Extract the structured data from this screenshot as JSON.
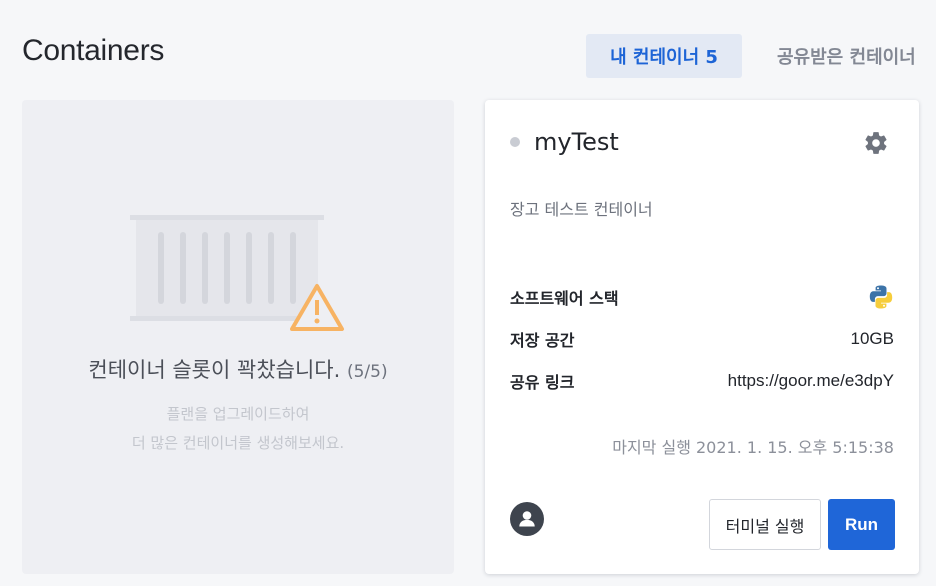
{
  "header": {
    "title": "Containers",
    "tabs": [
      {
        "label": "내 컨테이너 5",
        "active": true
      },
      {
        "label": "공유받은 컨테이너",
        "active": false
      }
    ]
  },
  "slots": {
    "message": "컨테이너 슬롯이 꽉찼습니다.",
    "count": "(5/5)",
    "hint_line1": "플랜을 업그레이드하여",
    "hint_line2": "더 많은 컨테이너를 생성해보세요.",
    "icons": [
      "container-icon",
      "warning-icon"
    ]
  },
  "container_card": {
    "name": "myTest",
    "status_color": "#c9ccd3",
    "description": "장고 테스트 컨테이너",
    "stack_label": "소프트웨어 스택",
    "stack_icon": "python-icon",
    "storage_label": "저장 공간",
    "storage_value": "10GB",
    "link_label": "공유 링크",
    "link_value": "https://goor.me/e3dpY",
    "last_run": "마지막 실행 2021. 1. 15. 오후 5:15:38",
    "terminal_button": "터미널 실행",
    "run_button": "Run",
    "icons": [
      "gear-icon",
      "user-avatar-icon"
    ]
  },
  "colors": {
    "accent": "#1f66d8",
    "active_tab_bg": "#e3e9f4",
    "warning": "#f7b363"
  }
}
